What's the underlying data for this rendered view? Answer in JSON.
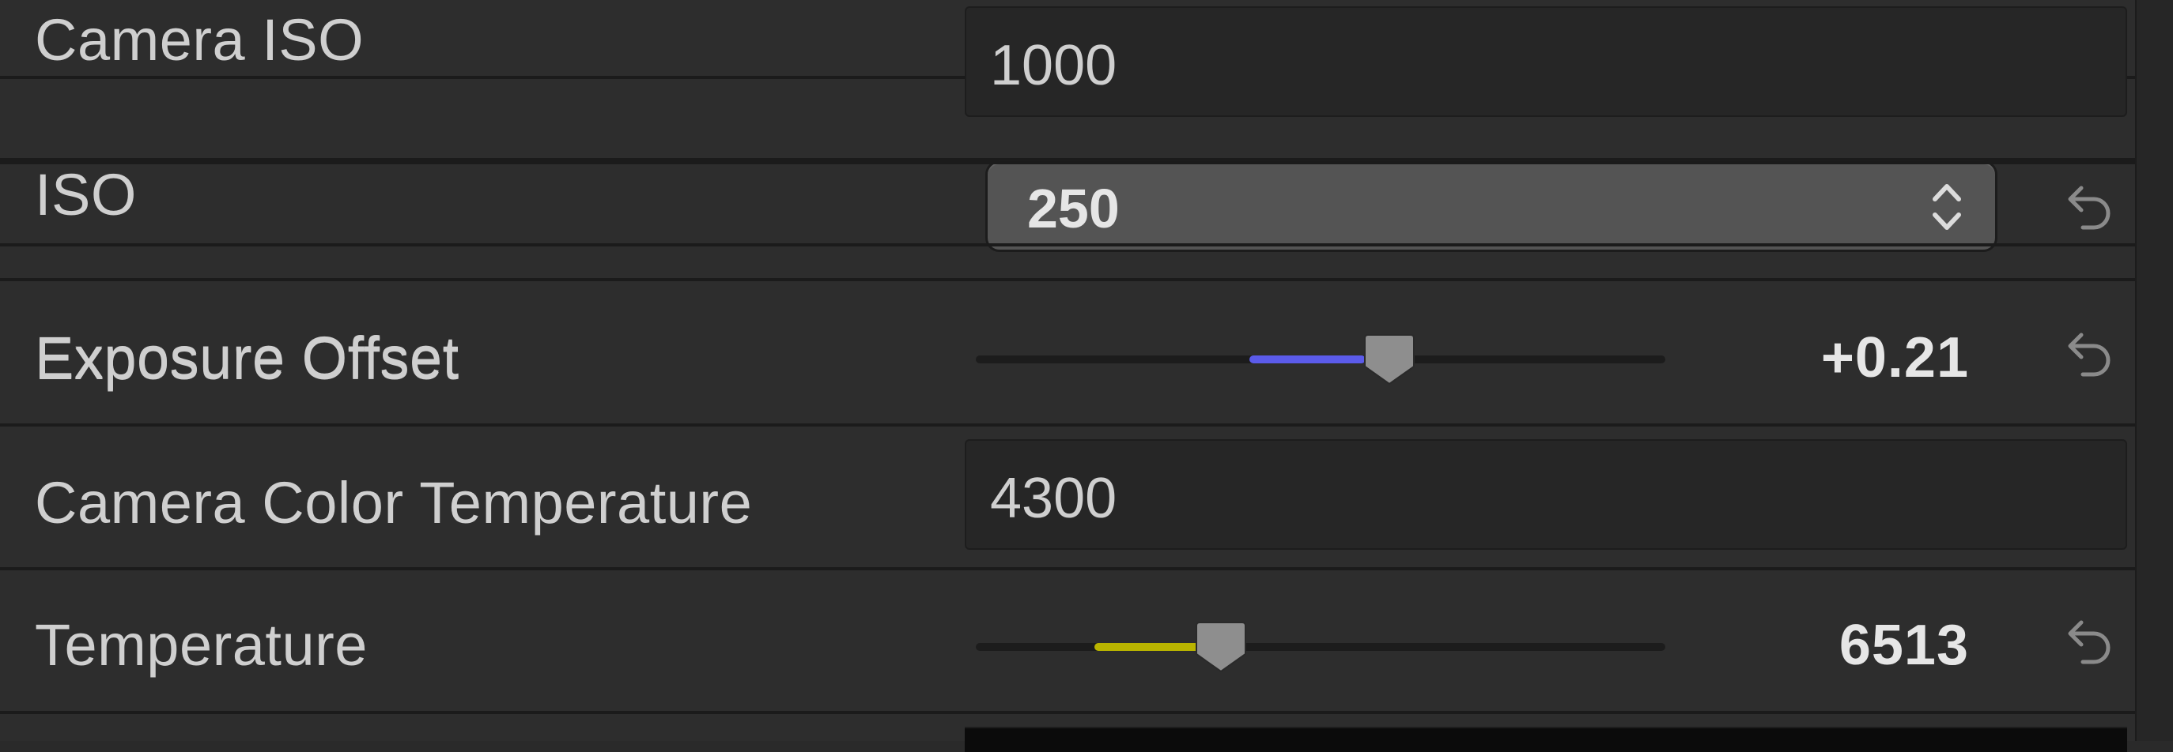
{
  "rows": {
    "camera_iso": {
      "label": "Camera ISO",
      "value": "1000"
    },
    "iso": {
      "label": "ISO",
      "value": "250"
    },
    "exposure_offset": {
      "label": "Exposure Offset",
      "value": "+0.21",
      "slider_fraction": 0.6,
      "fill_color": "#5b5bea"
    },
    "camera_color_temperature": {
      "label": "Camera Color Temperature",
      "value": "4300"
    },
    "temperature": {
      "label": "Temperature",
      "value": "6513",
      "slider_fraction": 0.355,
      "fill_color": "#b9b400"
    }
  },
  "icons": {
    "reset": "reset-arrow-icon",
    "stepper": "up-down-chevron-icon",
    "thumb": "slider-thumb-icon"
  },
  "colors": {
    "panel_bg": "#2d2d2d",
    "field_bg": "#262626",
    "stepper_bg": "#545454",
    "text": "#cfcfcf"
  }
}
